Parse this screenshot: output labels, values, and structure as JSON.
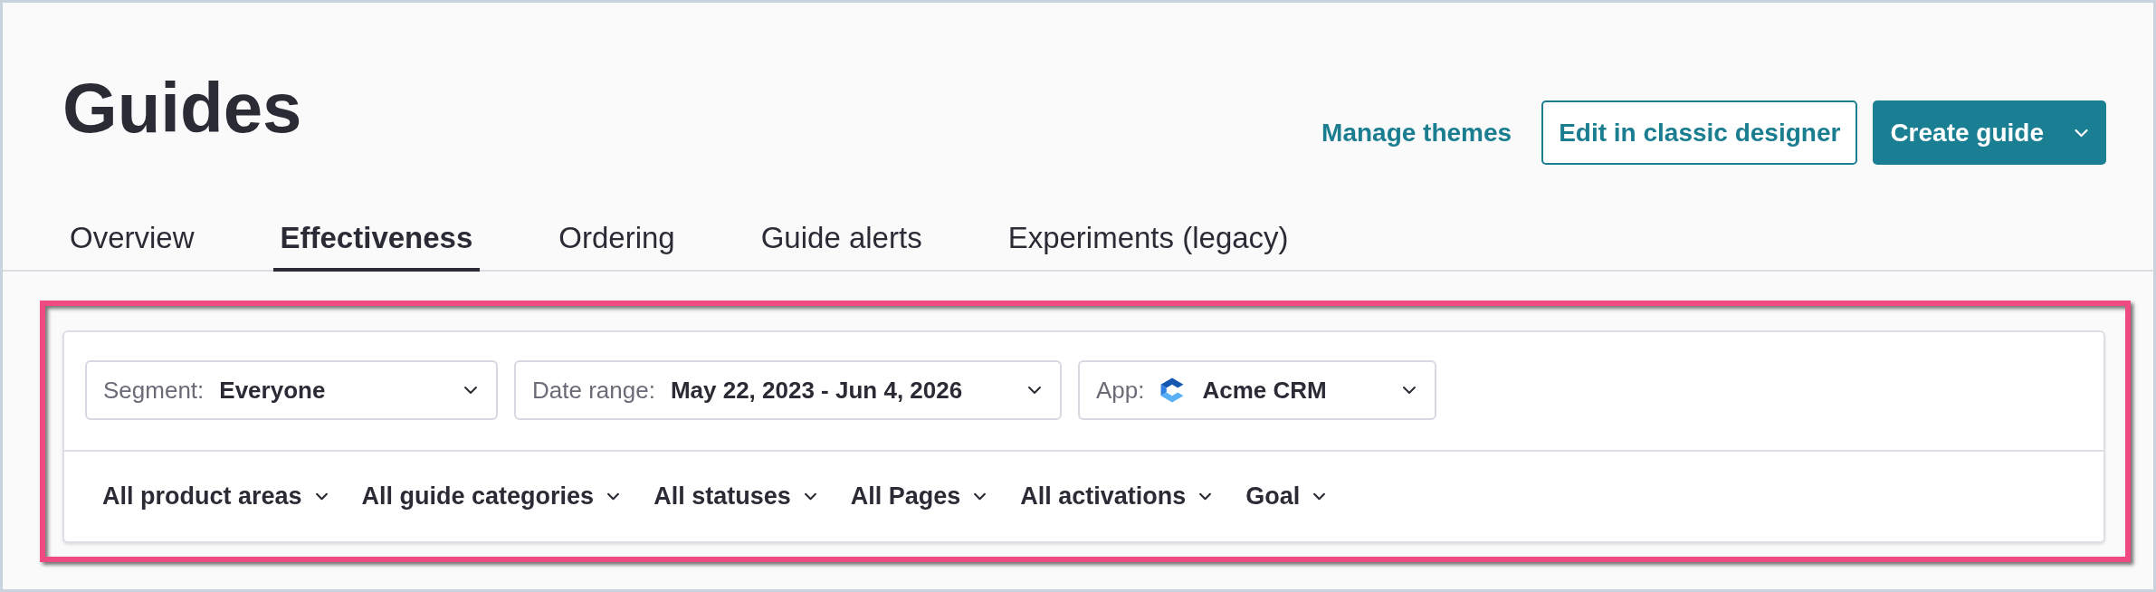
{
  "page": {
    "title": "Guides"
  },
  "header_actions": {
    "link": "Manage themes",
    "secondary_button": "Edit in classic designer",
    "primary_button": "Create guide"
  },
  "tabs": [
    {
      "label": "Overview",
      "selected": false
    },
    {
      "label": "Effectiveness",
      "selected": true
    },
    {
      "label": "Ordering",
      "selected": false
    },
    {
      "label": "Guide alerts",
      "selected": false
    },
    {
      "label": "Experiments (legacy)",
      "selected": false
    }
  ],
  "filters": {
    "highlighted": true,
    "dropdowns": [
      {
        "kind": "text",
        "label": "Segment:",
        "value": "Everyone"
      },
      {
        "kind": "text",
        "label": "Date range:",
        "value": "May 22, 2023 - Jun 4, 2026"
      },
      {
        "kind": "app",
        "label": "App:",
        "value": "Acme CRM"
      }
    ],
    "menus": [
      "All product areas",
      "All guide categories",
      "All statuses",
      "All Pages",
      "All activations",
      "Goal"
    ]
  }
}
